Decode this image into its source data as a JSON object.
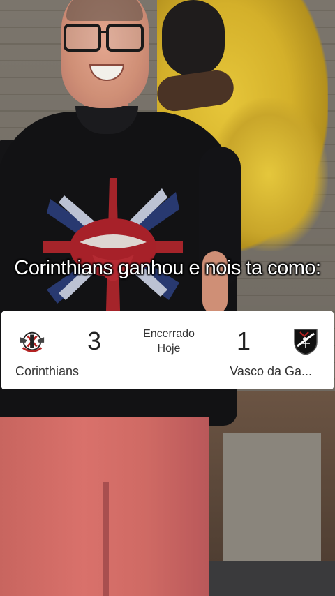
{
  "caption": "Corinthians ganhou e nois ta como:",
  "match": {
    "status": "Encerrado",
    "date": "Hoje",
    "home": {
      "name": "Corinthians",
      "score": "3",
      "logo": "corinthians-crest-icon"
    },
    "away": {
      "name": "Vasco da Ga...",
      "score": "1",
      "logo": "vasco-crest-icon"
    }
  },
  "colors": {
    "card_background": "#ffffff",
    "caption_text": "#ffffff",
    "shirt": "#121214",
    "pants": "#d9716b",
    "celebrating_players_kit": "#e6c63a"
  }
}
